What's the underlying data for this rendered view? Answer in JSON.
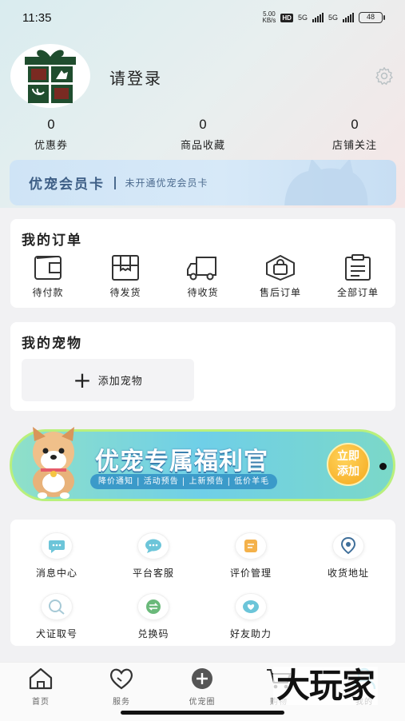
{
  "status": {
    "time": "11:35",
    "speed_value": "5.00",
    "speed_unit": "KB/s",
    "hd": "HD",
    "net1": "5G",
    "net2": "5G",
    "battery": "48"
  },
  "profile": {
    "login_text": "请登录"
  },
  "stats": [
    {
      "value": "0",
      "label": "优惠券"
    },
    {
      "value": "0",
      "label": "商品收藏"
    },
    {
      "value": "0",
      "label": "店铺关注"
    }
  ],
  "member": {
    "title": "优宠会员卡",
    "subtitle": "未开通优宠会员卡"
  },
  "orders": {
    "title": "我的订单",
    "items": [
      {
        "label": "待付款",
        "icon": "wallet-icon"
      },
      {
        "label": "待发货",
        "icon": "box-icon"
      },
      {
        "label": "待收货",
        "icon": "truck-icon"
      },
      {
        "label": "售后订单",
        "icon": "bag-icon"
      },
      {
        "label": "全部订单",
        "icon": "clipboard-icon"
      }
    ]
  },
  "pets": {
    "title": "我的宠物",
    "add_label": "添加宠物"
  },
  "banner": {
    "title": "优宠专属福利官",
    "tags": "降价通知 | 活动预告 | 上新预告 | 低价羊毛",
    "button_line1": "立即",
    "button_line2": "添加"
  },
  "services": [
    {
      "label": "消息中心",
      "icon": "message-icon",
      "color": "#6cc5d9"
    },
    {
      "label": "平台客服",
      "icon": "chat-icon",
      "color": "#6cc5d9"
    },
    {
      "label": "评价管理",
      "icon": "review-icon",
      "color": "#f4b14a"
    },
    {
      "label": "收货地址",
      "icon": "location-icon",
      "color": "#3f6f9a"
    },
    {
      "label": "犬证取号",
      "icon": "search-icon",
      "color": "#a6c9d6"
    },
    {
      "label": "兑换码",
      "icon": "exchange-icon",
      "color": "#6ab97a"
    },
    {
      "label": "好友助力",
      "icon": "heart-icon",
      "color": "#6cc5d9"
    }
  ],
  "tabs": [
    {
      "label": "首页",
      "icon": "home-icon"
    },
    {
      "label": "服务",
      "icon": "heart-tab-icon"
    },
    {
      "label": "优宠圈",
      "icon": "plus-circle-icon"
    },
    {
      "label": "购物",
      "icon": "cart-icon"
    },
    {
      "label": "我的",
      "icon": "user-icon"
    }
  ],
  "watermark": "大玩家"
}
